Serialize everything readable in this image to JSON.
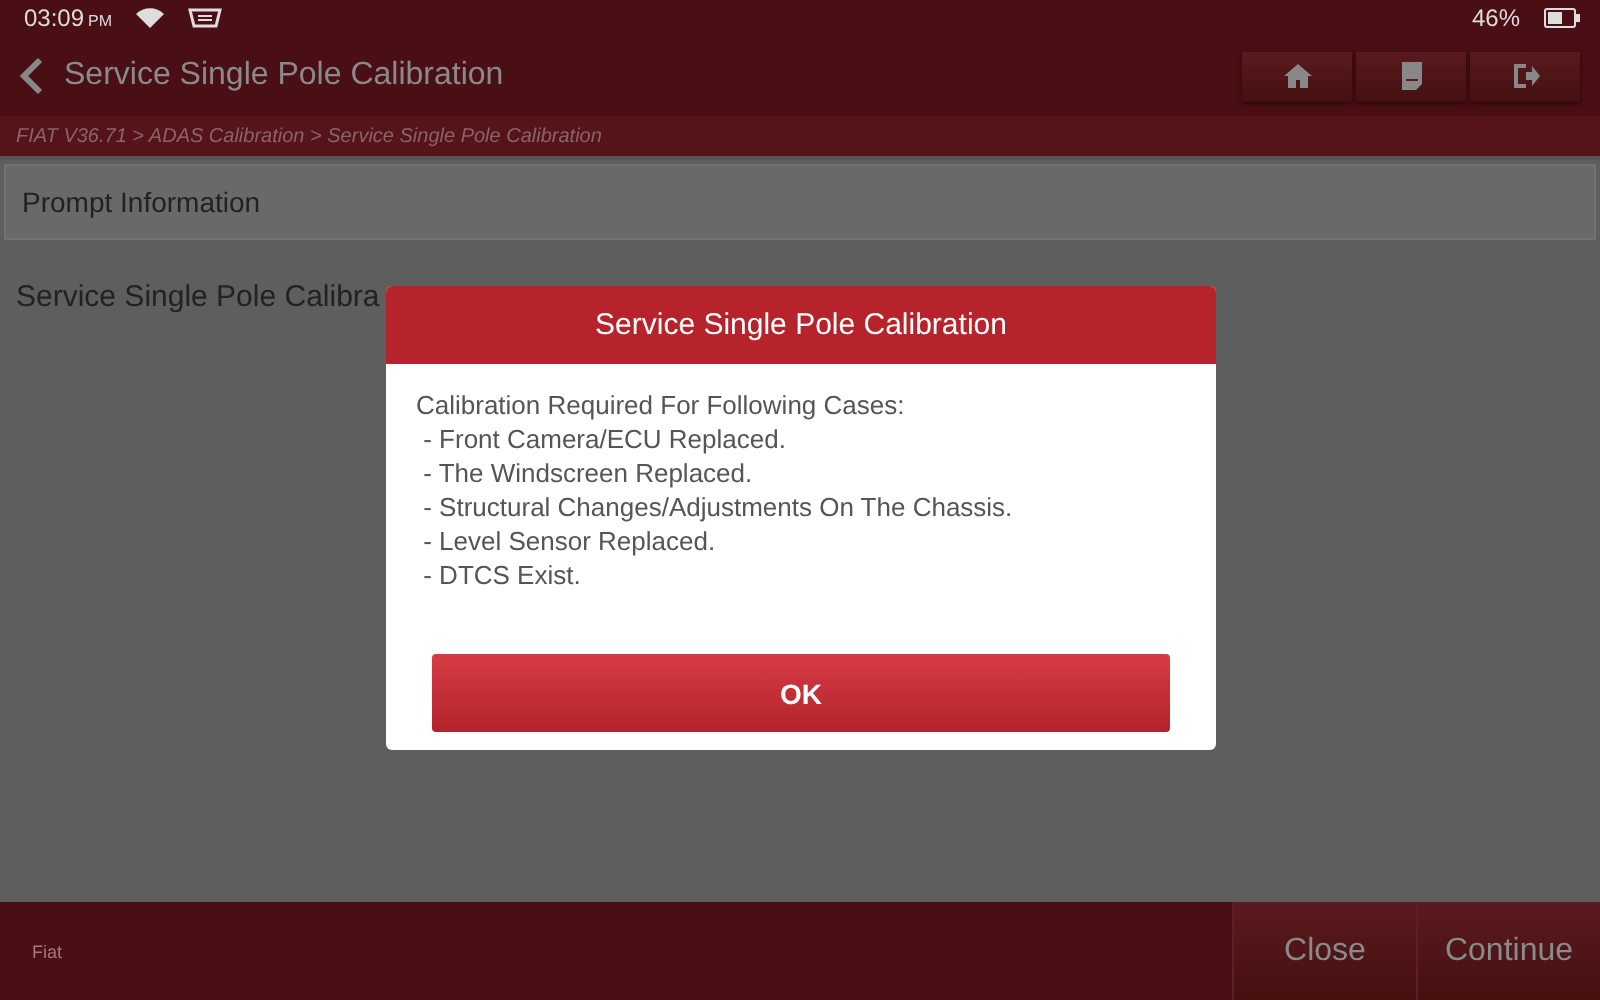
{
  "status_bar": {
    "time": "03:09",
    "ampm": "PM",
    "battery": "46%"
  },
  "header": {
    "title": "Service Single Pole Calibration"
  },
  "breadcrumb": "FIAT V36.71 > ADAS Calibration > Service Single Pole Calibration",
  "prompt_bar": {
    "title": "Prompt Information"
  },
  "content_text": "Service Single Pole Calibra",
  "dialog": {
    "title": "Service Single Pole Calibration",
    "lines": [
      "Calibration Required For Following Cases:",
      " - Front Camera/ECU Replaced.",
      " - The Windscreen Replaced.",
      " - Structural Changes/Adjustments On The Chassis.",
      " - Level Sensor Replaced.",
      " - DTCS Exist."
    ],
    "button": "OK"
  },
  "footer": {
    "label": "Fiat",
    "buttons": [
      "Close",
      "Continue"
    ]
  }
}
